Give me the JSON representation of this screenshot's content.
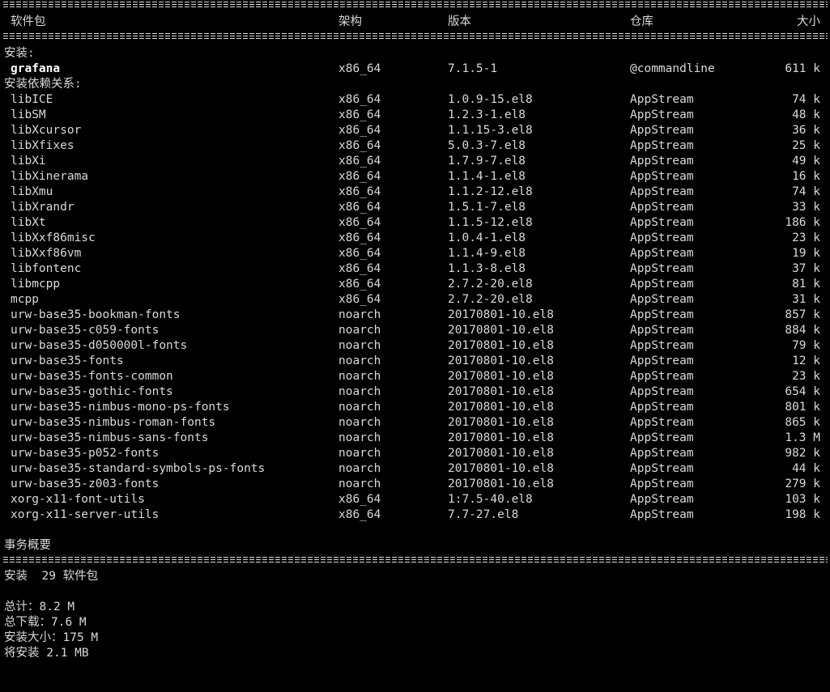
{
  "header": {
    "package": "软件包",
    "arch": "架构",
    "version": "版本",
    "repo": "仓库",
    "size": "大小"
  },
  "sections": {
    "install_label": "安装:",
    "deps_label": "安装依赖关系:"
  },
  "install": [
    {
      "name": "grafana",
      "arch": "x86_64",
      "version": "7.1.5-1",
      "repo": "@commandline",
      "size": "611 k"
    }
  ],
  "deps": [
    {
      "name": "libICE",
      "arch": "x86_64",
      "version": "1.0.9-15.el8",
      "repo": "AppStream",
      "size": "74 k"
    },
    {
      "name": "libSM",
      "arch": "x86_64",
      "version": "1.2.3-1.el8",
      "repo": "AppStream",
      "size": "48 k"
    },
    {
      "name": "libXcursor",
      "arch": "x86_64",
      "version": "1.1.15-3.el8",
      "repo": "AppStream",
      "size": "36 k"
    },
    {
      "name": "libXfixes",
      "arch": "x86_64",
      "version": "5.0.3-7.el8",
      "repo": "AppStream",
      "size": "25 k"
    },
    {
      "name": "libXi",
      "arch": "x86_64",
      "version": "1.7.9-7.el8",
      "repo": "AppStream",
      "size": "49 k"
    },
    {
      "name": "libXinerama",
      "arch": "x86_64",
      "version": "1.1.4-1.el8",
      "repo": "AppStream",
      "size": "16 k"
    },
    {
      "name": "libXmu",
      "arch": "x86_64",
      "version": "1.1.2-12.el8",
      "repo": "AppStream",
      "size": "74 k"
    },
    {
      "name": "libXrandr",
      "arch": "x86_64",
      "version": "1.5.1-7.el8",
      "repo": "AppStream",
      "size": "33 k"
    },
    {
      "name": "libXt",
      "arch": "x86_64",
      "version": "1.1.5-12.el8",
      "repo": "AppStream",
      "size": "186 k"
    },
    {
      "name": "libXxf86misc",
      "arch": "x86_64",
      "version": "1.0.4-1.el8",
      "repo": "AppStream",
      "size": "23 k"
    },
    {
      "name": "libXxf86vm",
      "arch": "x86_64",
      "version": "1.1.4-9.el8",
      "repo": "AppStream",
      "size": "19 k"
    },
    {
      "name": "libfontenc",
      "arch": "x86_64",
      "version": "1.1.3-8.el8",
      "repo": "AppStream",
      "size": "37 k"
    },
    {
      "name": "libmcpp",
      "arch": "x86_64",
      "version": "2.7.2-20.el8",
      "repo": "AppStream",
      "size": "81 k"
    },
    {
      "name": "mcpp",
      "arch": "x86_64",
      "version": "2.7.2-20.el8",
      "repo": "AppStream",
      "size": "31 k"
    },
    {
      "name": "urw-base35-bookman-fonts",
      "arch": "noarch",
      "version": "20170801-10.el8",
      "repo": "AppStream",
      "size": "857 k"
    },
    {
      "name": "urw-base35-c059-fonts",
      "arch": "noarch",
      "version": "20170801-10.el8",
      "repo": "AppStream",
      "size": "884 k"
    },
    {
      "name": "urw-base35-d050000l-fonts",
      "arch": "noarch",
      "version": "20170801-10.el8",
      "repo": "AppStream",
      "size": "79 k"
    },
    {
      "name": "urw-base35-fonts",
      "arch": "noarch",
      "version": "20170801-10.el8",
      "repo": "AppStream",
      "size": "12 k"
    },
    {
      "name": "urw-base35-fonts-common",
      "arch": "noarch",
      "version": "20170801-10.el8",
      "repo": "AppStream",
      "size": "23 k"
    },
    {
      "name": "urw-base35-gothic-fonts",
      "arch": "noarch",
      "version": "20170801-10.el8",
      "repo": "AppStream",
      "size": "654 k"
    },
    {
      "name": "urw-base35-nimbus-mono-ps-fonts",
      "arch": "noarch",
      "version": "20170801-10.el8",
      "repo": "AppStream",
      "size": "801 k"
    },
    {
      "name": "urw-base35-nimbus-roman-fonts",
      "arch": "noarch",
      "version": "20170801-10.el8",
      "repo": "AppStream",
      "size": "865 k"
    },
    {
      "name": "urw-base35-nimbus-sans-fonts",
      "arch": "noarch",
      "version": "20170801-10.el8",
      "repo": "AppStream",
      "size": "1.3 M"
    },
    {
      "name": "urw-base35-p052-fonts",
      "arch": "noarch",
      "version": "20170801-10.el8",
      "repo": "AppStream",
      "size": "982 k"
    },
    {
      "name": "urw-base35-standard-symbols-ps-fonts",
      "arch": "noarch",
      "version": "20170801-10.el8",
      "repo": "AppStream",
      "size": "44 k"
    },
    {
      "name": "urw-base35-z003-fonts",
      "arch": "noarch",
      "version": "20170801-10.el8",
      "repo": "AppStream",
      "size": "279 k"
    },
    {
      "name": "xorg-x11-font-utils",
      "arch": "x86_64",
      "version": "1:7.5-40.el8",
      "repo": "AppStream",
      "size": "103 k"
    },
    {
      "name": "xorg-x11-server-utils",
      "arch": "x86_64",
      "version": "7.7-27.el8",
      "repo": "AppStream",
      "size": "198 k"
    }
  ],
  "summary": {
    "title": "事务概要",
    "install_line": "安装  29 软件包",
    "total": "总计：8.2 M",
    "download": "总下载：7.6 M",
    "installed_size": "安装大小：175 M",
    "partial": "将安装 2.1 MB"
  }
}
